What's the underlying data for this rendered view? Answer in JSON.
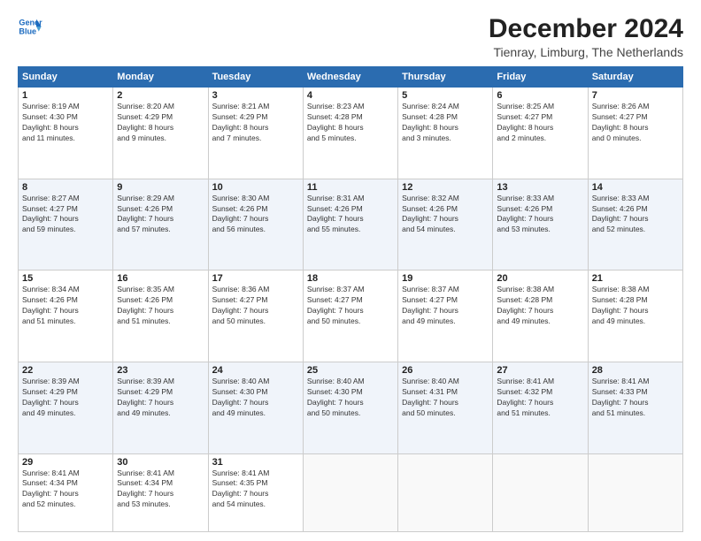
{
  "logo": {
    "line1": "General",
    "line2": "Blue"
  },
  "title": "December 2024",
  "subtitle": "Tienray, Limburg, The Netherlands",
  "weekdays": [
    "Sunday",
    "Monday",
    "Tuesday",
    "Wednesday",
    "Thursday",
    "Friday",
    "Saturday"
  ],
  "weeks": [
    [
      {
        "day": "1",
        "info": "Sunrise: 8:19 AM\nSunset: 4:30 PM\nDaylight: 8 hours\nand 11 minutes."
      },
      {
        "day": "2",
        "info": "Sunrise: 8:20 AM\nSunset: 4:29 PM\nDaylight: 8 hours\nand 9 minutes."
      },
      {
        "day": "3",
        "info": "Sunrise: 8:21 AM\nSunset: 4:29 PM\nDaylight: 8 hours\nand 7 minutes."
      },
      {
        "day": "4",
        "info": "Sunrise: 8:23 AM\nSunset: 4:28 PM\nDaylight: 8 hours\nand 5 minutes."
      },
      {
        "day": "5",
        "info": "Sunrise: 8:24 AM\nSunset: 4:28 PM\nDaylight: 8 hours\nand 3 minutes."
      },
      {
        "day": "6",
        "info": "Sunrise: 8:25 AM\nSunset: 4:27 PM\nDaylight: 8 hours\nand 2 minutes."
      },
      {
        "day": "7",
        "info": "Sunrise: 8:26 AM\nSunset: 4:27 PM\nDaylight: 8 hours\nand 0 minutes."
      }
    ],
    [
      {
        "day": "8",
        "info": "Sunrise: 8:27 AM\nSunset: 4:27 PM\nDaylight: 7 hours\nand 59 minutes."
      },
      {
        "day": "9",
        "info": "Sunrise: 8:29 AM\nSunset: 4:26 PM\nDaylight: 7 hours\nand 57 minutes."
      },
      {
        "day": "10",
        "info": "Sunrise: 8:30 AM\nSunset: 4:26 PM\nDaylight: 7 hours\nand 56 minutes."
      },
      {
        "day": "11",
        "info": "Sunrise: 8:31 AM\nSunset: 4:26 PM\nDaylight: 7 hours\nand 55 minutes."
      },
      {
        "day": "12",
        "info": "Sunrise: 8:32 AM\nSunset: 4:26 PM\nDaylight: 7 hours\nand 54 minutes."
      },
      {
        "day": "13",
        "info": "Sunrise: 8:33 AM\nSunset: 4:26 PM\nDaylight: 7 hours\nand 53 minutes."
      },
      {
        "day": "14",
        "info": "Sunrise: 8:33 AM\nSunset: 4:26 PM\nDaylight: 7 hours\nand 52 minutes."
      }
    ],
    [
      {
        "day": "15",
        "info": "Sunrise: 8:34 AM\nSunset: 4:26 PM\nDaylight: 7 hours\nand 51 minutes."
      },
      {
        "day": "16",
        "info": "Sunrise: 8:35 AM\nSunset: 4:26 PM\nDaylight: 7 hours\nand 51 minutes."
      },
      {
        "day": "17",
        "info": "Sunrise: 8:36 AM\nSunset: 4:27 PM\nDaylight: 7 hours\nand 50 minutes."
      },
      {
        "day": "18",
        "info": "Sunrise: 8:37 AM\nSunset: 4:27 PM\nDaylight: 7 hours\nand 50 minutes."
      },
      {
        "day": "19",
        "info": "Sunrise: 8:37 AM\nSunset: 4:27 PM\nDaylight: 7 hours\nand 49 minutes."
      },
      {
        "day": "20",
        "info": "Sunrise: 8:38 AM\nSunset: 4:28 PM\nDaylight: 7 hours\nand 49 minutes."
      },
      {
        "day": "21",
        "info": "Sunrise: 8:38 AM\nSunset: 4:28 PM\nDaylight: 7 hours\nand 49 minutes."
      }
    ],
    [
      {
        "day": "22",
        "info": "Sunrise: 8:39 AM\nSunset: 4:29 PM\nDaylight: 7 hours\nand 49 minutes."
      },
      {
        "day": "23",
        "info": "Sunrise: 8:39 AM\nSunset: 4:29 PM\nDaylight: 7 hours\nand 49 minutes."
      },
      {
        "day": "24",
        "info": "Sunrise: 8:40 AM\nSunset: 4:30 PM\nDaylight: 7 hours\nand 49 minutes."
      },
      {
        "day": "25",
        "info": "Sunrise: 8:40 AM\nSunset: 4:30 PM\nDaylight: 7 hours\nand 50 minutes."
      },
      {
        "day": "26",
        "info": "Sunrise: 8:40 AM\nSunset: 4:31 PM\nDaylight: 7 hours\nand 50 minutes."
      },
      {
        "day": "27",
        "info": "Sunrise: 8:41 AM\nSunset: 4:32 PM\nDaylight: 7 hours\nand 51 minutes."
      },
      {
        "day": "28",
        "info": "Sunrise: 8:41 AM\nSunset: 4:33 PM\nDaylight: 7 hours\nand 51 minutes."
      }
    ],
    [
      {
        "day": "29",
        "info": "Sunrise: 8:41 AM\nSunset: 4:34 PM\nDaylight: 7 hours\nand 52 minutes."
      },
      {
        "day": "30",
        "info": "Sunrise: 8:41 AM\nSunset: 4:34 PM\nDaylight: 7 hours\nand 53 minutes."
      },
      {
        "day": "31",
        "info": "Sunrise: 8:41 AM\nSunset: 4:35 PM\nDaylight: 7 hours\nand 54 minutes."
      },
      null,
      null,
      null,
      null
    ]
  ]
}
